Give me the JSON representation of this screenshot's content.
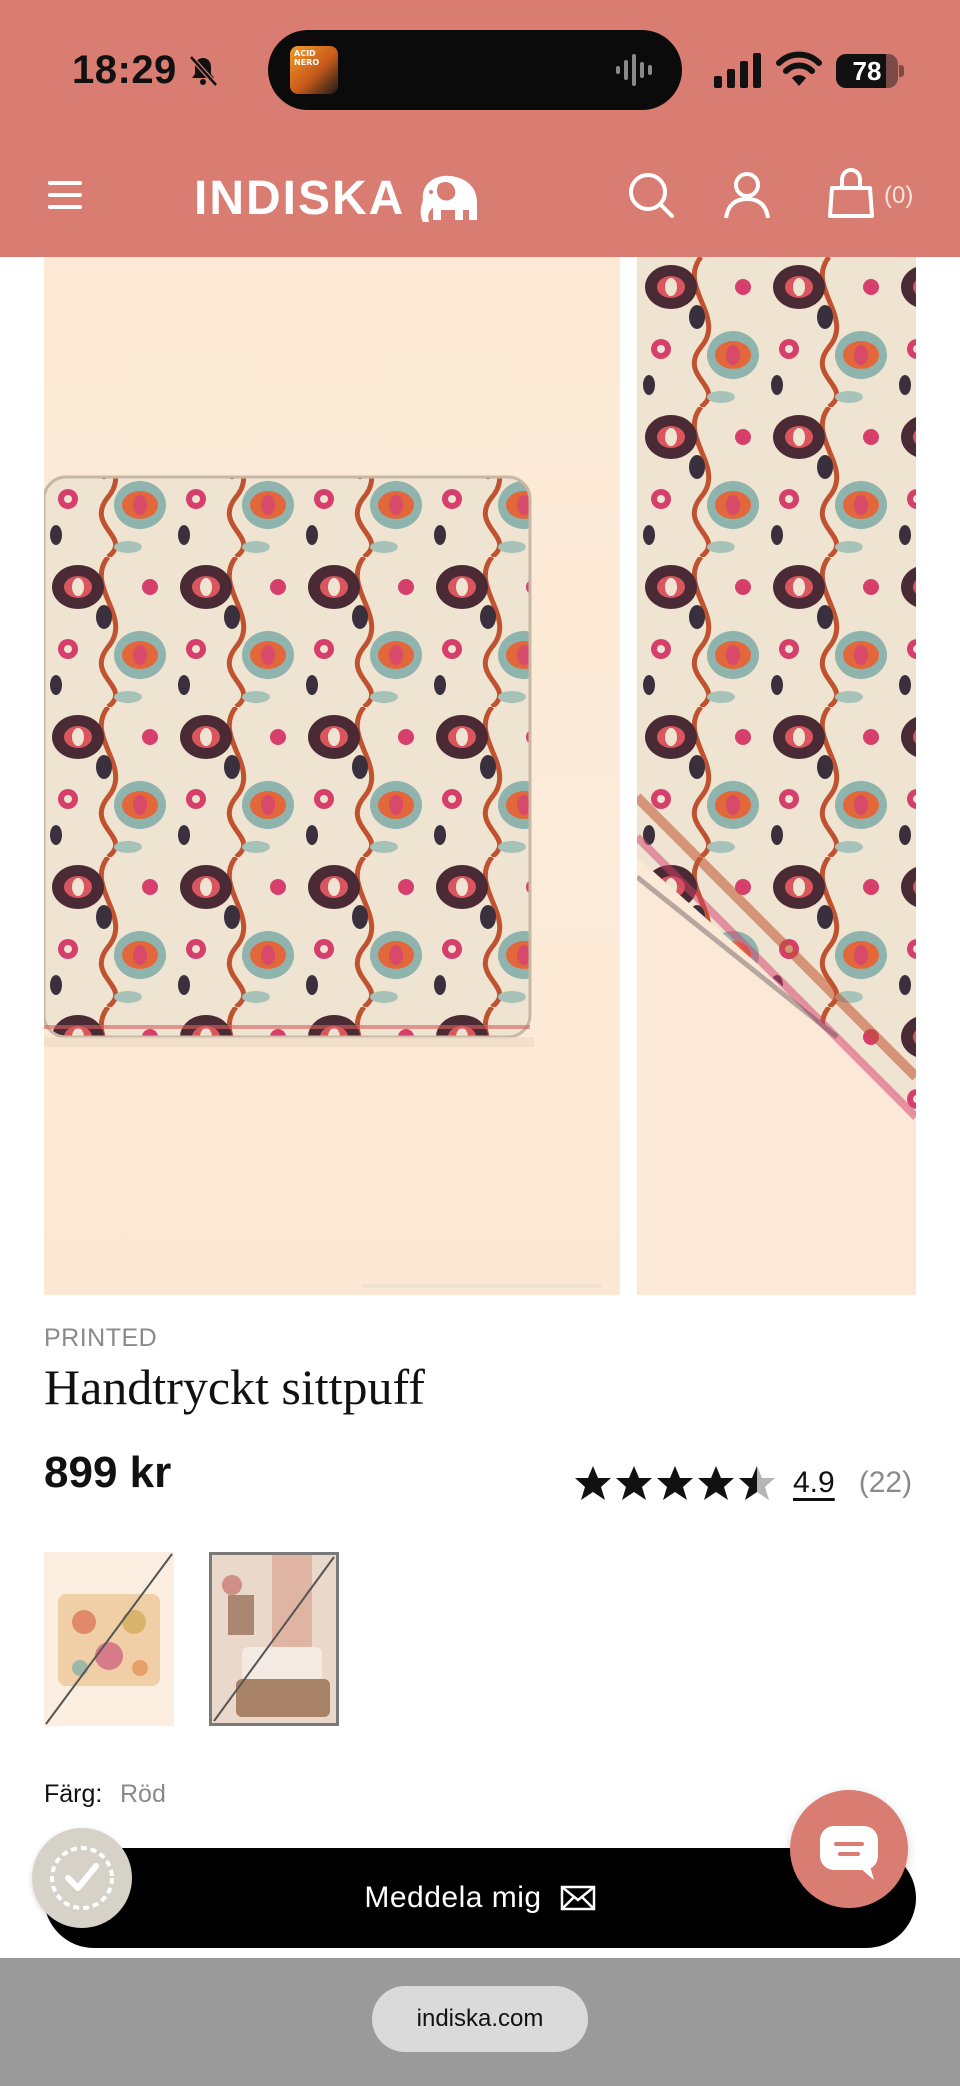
{
  "status_bar": {
    "time": "18:29",
    "battery": "78",
    "now_playing_art_text": "ACID NERO"
  },
  "header": {
    "logo_text": "INDISKA",
    "cart_count": "(0)",
    "background_color": "#d97c71"
  },
  "icons": [
    "bell-off-icon",
    "signal-icon",
    "wifi-icon",
    "battery-icon",
    "menu-icon",
    "elephant-logo-icon",
    "search-icon",
    "user-icon",
    "shopping-bag-icon",
    "star-icon",
    "mail-icon",
    "accessibility-icon",
    "chat-icon"
  ],
  "product": {
    "brand": "PRINTED",
    "title": "Handtryckt sittpuff",
    "price": "899 kr",
    "rating": {
      "value": "4.9",
      "count": "(22)",
      "stars": 4.5
    },
    "color_label": "Färg:",
    "color_value": "Röd",
    "notify_label": "Meddela mig"
  },
  "browser": {
    "url": "indiska.com"
  }
}
